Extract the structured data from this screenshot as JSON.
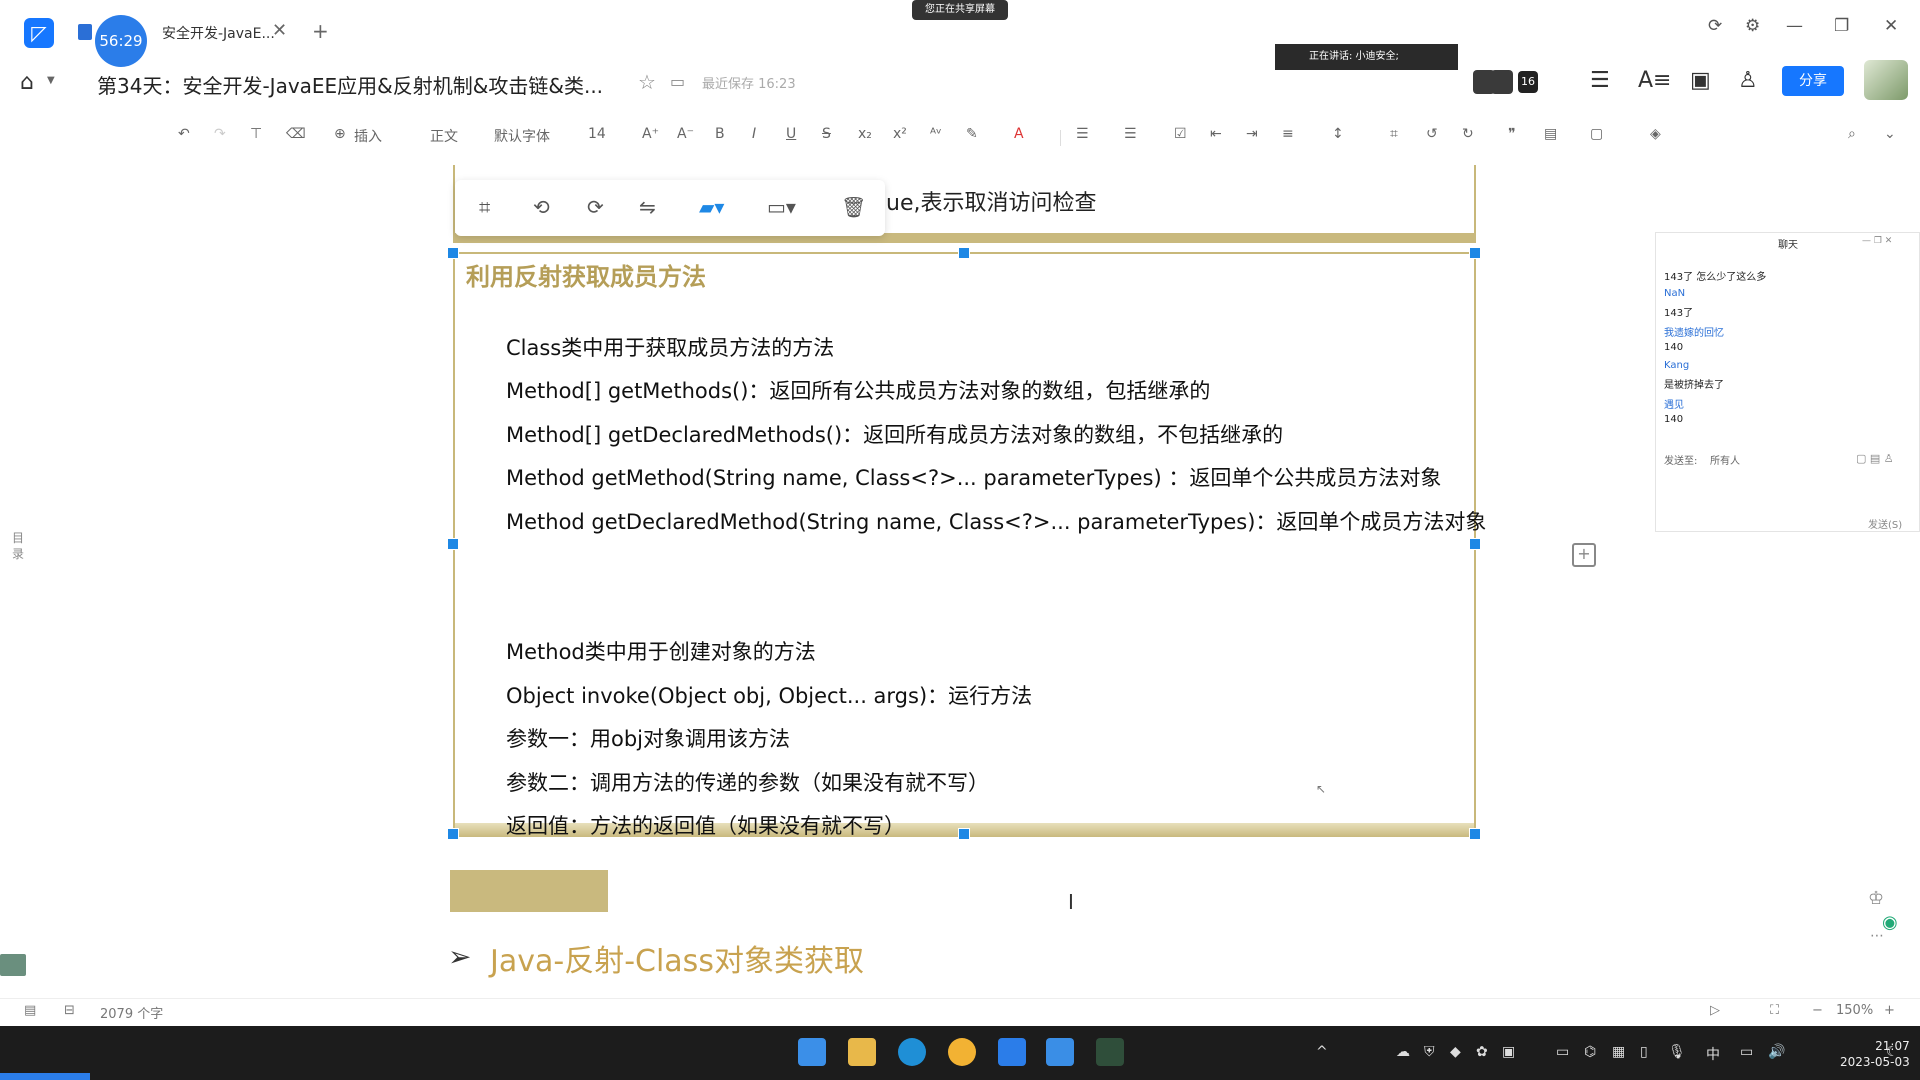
{
  "tab": {
    "timer": "56:29",
    "title": "安全开发-JavaE...",
    "close": "✕",
    "new": "+"
  },
  "banner": {
    "sharing": "您正在共享屏幕"
  },
  "header": {
    "doc_title": "第34天：安全开发-JavaEE应用&反射机制&攻击链&类...",
    "saved_status": "最近保存 16:23",
    "speaking": "正在讲话: 小迪安全;",
    "collab_count": "16",
    "share_button": "分享"
  },
  "toolbar": {
    "insert": "插入",
    "style": "正文",
    "font": "默认字体",
    "size": "14",
    "bold": "B",
    "italic": "I",
    "underline": "U",
    "strike": "S"
  },
  "image_toolbar": [
    "crop-icon",
    "rotate-left-icon",
    "rotate-right-icon",
    "flip-icon",
    "image-style-icon",
    "frame-icon",
    "delete-icon"
  ],
  "document": {
    "prev_text": "ue,表示取消访问检查",
    "heading": "利用反射获取成员方法",
    "lines": [
      "Class类中用于获取成员方法的方法",
      "Method[] getMethods()：返回所有公共成员方法对象的数组，包括继承的",
      "Method[] getDeclaredMethods()：返回所有成员方法对象的数组，不包括继承的",
      "Method getMethod(String name, Class<?>... parameterTypes) ：返回单个公共成员方法对象",
      "Method getDeclaredMethod(String name, Class<?>... parameterTypes)：返回单个成员方法对象"
    ],
    "lines2": [
      "Method类中用于创建对象的方法",
      "Object invoke(Object obj, Object... args)：运行方法",
      "参数一：用obj对象调用该方法",
      "参数二：调用方法的传递的参数（如果没有就不写）",
      "返回值：方法的返回值（如果没有就不写）"
    ],
    "section_title": "Java-反射-Class对象类获取",
    "toc_label": "目录"
  },
  "chat": {
    "title": "聊天",
    "messages": [
      {
        "text": "143了 怎么少了这么多",
        "color": "dark"
      },
      {
        "text": "NaN",
        "color": "blue"
      },
      {
        "text": "143了",
        "color": "dark"
      },
      {
        "text": "我遗嫁的回忆",
        "color": "blue"
      },
      {
        "text": "140",
        "color": "dark"
      },
      {
        "text": "Kang",
        "color": "blue"
      },
      {
        "text": "是被挤掉去了",
        "color": "dark"
      },
      {
        "text": "遇见",
        "color": "blue"
      },
      {
        "text": "140",
        "color": "dark"
      }
    ],
    "send_to_label": "发送至:",
    "send_to_value": "所有人",
    "send_button": "发送(S)"
  },
  "status": {
    "word_count": "2079 个字",
    "zoom": "150%"
  },
  "taskbar": {
    "time": "21:07",
    "date": "2023-05-03",
    "ime": "中"
  },
  "colors": {
    "accent": "#1677ff",
    "highlight": "#c9b97e",
    "heading": "#b59e58",
    "section": "#c8a24f"
  }
}
